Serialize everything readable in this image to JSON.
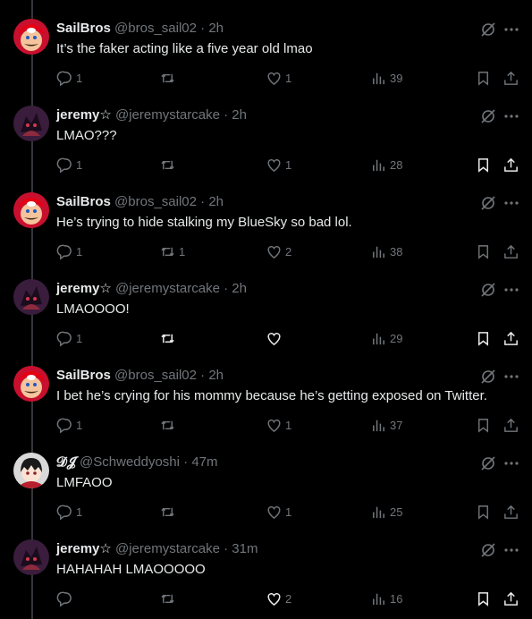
{
  "colors": {
    "background": "#000000",
    "text": "#e7e9ea",
    "muted": "#71767b",
    "line": "#333639"
  },
  "tweets": [
    {
      "name": "SailBros",
      "handle": "@bros_sail02",
      "dot": "·",
      "time": "2h",
      "text": "It’s the faker acting like a five year old lmao",
      "avatar": "mario-avatar",
      "replies": "1",
      "retweets": "",
      "likes": "1",
      "views": "39"
    },
    {
      "name": "jeremy☆",
      "handle": "@jeremystarcake",
      "dot": "·",
      "time": "2h",
      "text": "LMAO???",
      "avatar": "shadow-avatar",
      "replies": "1",
      "retweets": "",
      "likes": "1",
      "views": "28"
    },
    {
      "name": "SailBros",
      "handle": "@bros_sail02",
      "dot": "·",
      "time": "2h",
      "text": "He’s trying to hide stalking my BlueSky so bad lol.",
      "avatar": "mario-avatar",
      "replies": "1",
      "retweets": "1",
      "likes": "2",
      "views": "38"
    },
    {
      "name": "jeremy☆",
      "handle": "@jeremystarcake",
      "dot": "·",
      "time": "2h",
      "text": "LMAOOOO!",
      "avatar": "shadow-avatar",
      "replies": "1",
      "retweets": "",
      "likes": "",
      "views": "29"
    },
    {
      "name": "SailBros",
      "handle": "@bros_sail02",
      "dot": "·",
      "time": "2h",
      "text": "I bet he’s crying for his mommy because he’s getting exposed on Twitter.",
      "avatar": "mario-avatar",
      "replies": "1",
      "retweets": "",
      "likes": "1",
      "views": "37"
    },
    {
      "name": "𝓓𝓙",
      "handle": "@Schweddyoshi",
      "dot": "·",
      "time": "47m",
      "text": "LMFAOO",
      "avatar": "anime-avatar",
      "replies": "1",
      "retweets": "",
      "likes": "1",
      "views": "25"
    },
    {
      "name": "jeremy☆",
      "handle": "@jeremystarcake",
      "dot": "·",
      "time": "31m",
      "text": "HAHAHAH LMAOOOOO",
      "avatar": "shadow-avatar",
      "replies": "",
      "retweets": "",
      "likes": "2",
      "views": "16"
    }
  ]
}
